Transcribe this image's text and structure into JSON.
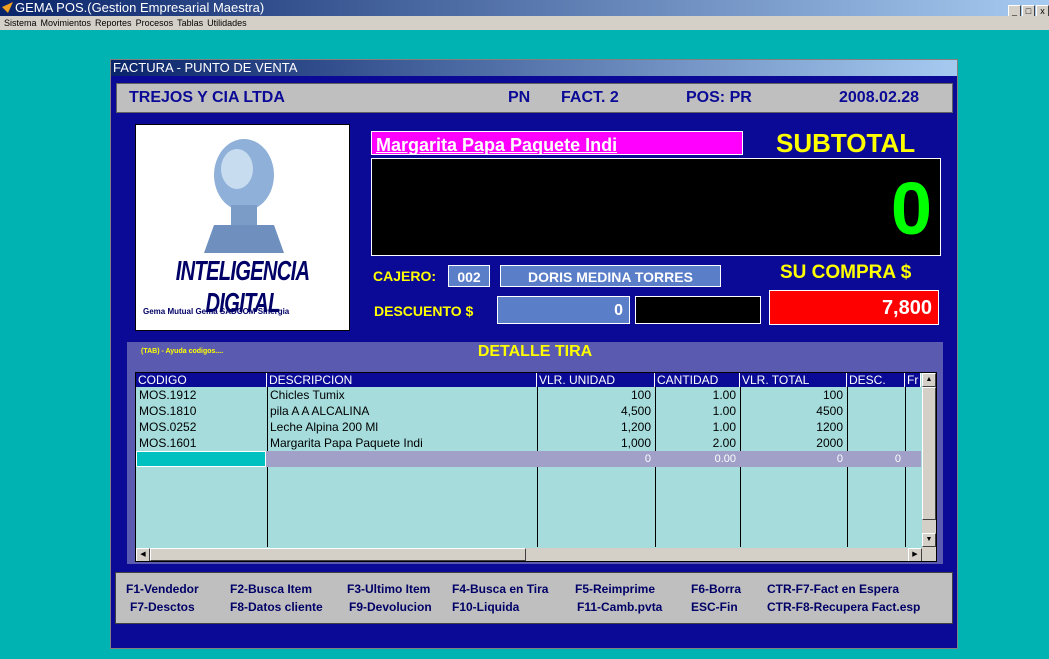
{
  "app": {
    "title": "GEMA POS.(Gestion Empresarial Maestra)"
  },
  "menu": [
    "Sistema",
    "Movimientos",
    "Reportes",
    "Procesos",
    "Tablas",
    "Utilidades"
  ],
  "form": {
    "title": "FACTURA - PUNTO DE VENTA"
  },
  "header": {
    "company": "TREJOS Y CIA LTDA",
    "pn": "PN",
    "fact": "FACT. 2",
    "pos": "POS: PR",
    "date": "2008.02.28"
  },
  "logo": {
    "brand": "INTELIGENCIA DIGITAL",
    "partners": "Gema  Mutual  Gema  SADCOM  Sinergia"
  },
  "customer": {
    "name": "Margarita Papa Paquete Indi"
  },
  "subtotal": {
    "label": "SUBTOTAL",
    "value": "0"
  },
  "cashier": {
    "label": "CAJERO:",
    "code": "002",
    "name": "DORIS MEDINA TORRES"
  },
  "discount": {
    "label": "DESCUENTO $",
    "value": "0"
  },
  "purchase": {
    "label": "SU COMPRA $",
    "value": "7,800"
  },
  "detail": {
    "help": "(TAB) - Ayuda codigos....",
    "title": "DETALLE TIRA",
    "columns": [
      "CODIGO",
      "DESCRIPCION",
      "VLR. UNIDAD",
      "CANTIDAD",
      "VLR. TOTAL",
      "DESC.",
      "Fr"
    ],
    "rows": [
      [
        "MOS.1912",
        "Chicles Tumix",
        "100",
        "1.00",
        "100"
      ],
      [
        "MOS.1810",
        "pila A A ALCALINA",
        "4,500",
        "1.00",
        "4500"
      ],
      [
        "MOS.0252",
        "Leche Alpina 200 Ml",
        "1,200",
        "1.00",
        "1200"
      ],
      [
        "MOS.1601",
        "Margarita Papa Paquete Indi",
        "1,000",
        "2.00",
        "2000"
      ]
    ],
    "entry": [
      "0",
      "0.00",
      "0",
      "0"
    ]
  },
  "keys": [
    "F1-Vendedor",
    "F2-Busca Item",
    "F3-Ultimo Item",
    "F4-Busca en Tira",
    "F5-Reimprime",
    "F6-Borra",
    "CTR-F7-Fact en Espera",
    "F7-Desctos",
    "F8-Datos cliente",
    "F9-Devolucion",
    "F10-Liquida",
    "F11-Camb.pvta",
    "ESC-Fin",
    "CTR-F8-Recupera Fact.esp"
  ],
  "colors": {
    "desktop": "#00b3b3",
    "form": "#0a0a96",
    "subtotal": "#00ff00",
    "purchase": "#ff0000",
    "highlight": "#ffff00"
  },
  "icons": [
    "app-logo-icon",
    "minimize-icon",
    "maximize-icon",
    "close-icon",
    "scroll-up-icon",
    "scroll-down-icon",
    "scroll-left-icon",
    "scroll-right-icon"
  ]
}
